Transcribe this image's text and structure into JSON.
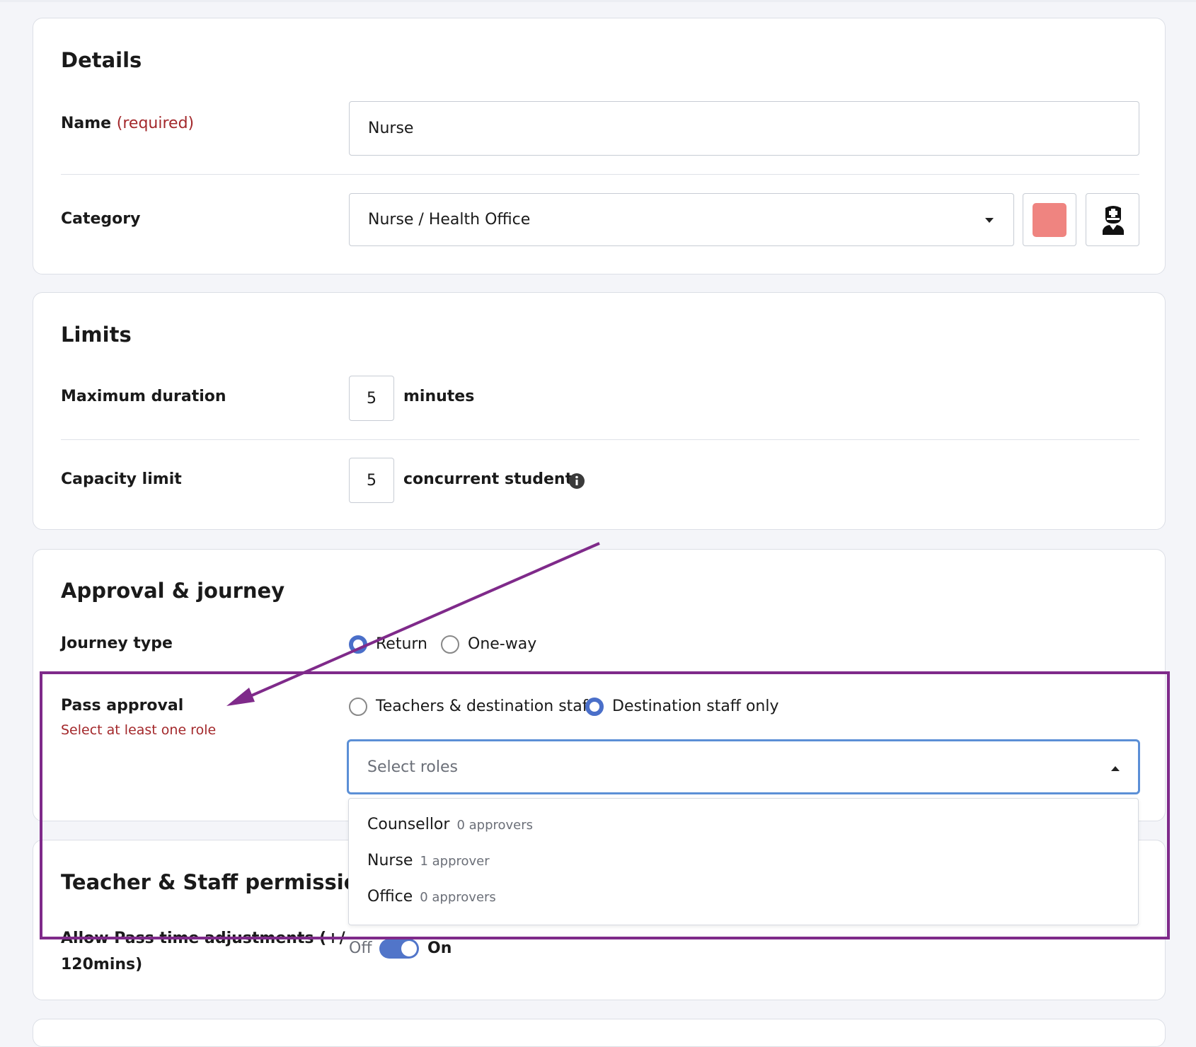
{
  "details": {
    "title": "Details",
    "name_label": "Name",
    "name_required": "(required)",
    "name_value": "Nurse",
    "category_label": "Category",
    "category_value": "Nurse / Health Office",
    "category_color": "#ef8480",
    "category_icon": "nurse-icon"
  },
  "limits": {
    "title": "Limits",
    "max_duration_label": "Maximum duration",
    "max_duration_value": "5",
    "max_duration_unit": "minutes",
    "capacity_label": "Capacity limit",
    "capacity_value": "5",
    "capacity_unit": "concurrent students",
    "info_icon": "info-icon"
  },
  "approval": {
    "title": "Approval & journey",
    "journey_label": "Journey type",
    "journey_options": [
      "Return",
      "One-way"
    ],
    "journey_selected": "Return",
    "pass_approval_label": "Pass approval",
    "pass_approval_error": "Select at least one role",
    "approval_options": [
      "Teachers & destination staff",
      "Destination staff only"
    ],
    "approval_selected": "Destination staff only",
    "roles_placeholder": "Select roles",
    "roles_options": [
      {
        "name": "Counsellor",
        "count": "0 approvers"
      },
      {
        "name": "Nurse",
        "count": "1 approver"
      },
      {
        "name": "Office",
        "count": "0 approvers"
      }
    ]
  },
  "permissions": {
    "title": "Teacher & Staff permissions",
    "adjust_label_line1": "Allow Pass time adjustments (+/-",
    "adjust_label_line2": "120mins)",
    "toggle_off": "Off",
    "toggle_on": "On",
    "toggle_state": "on"
  },
  "annotation": {
    "color": "#7f2a8a"
  }
}
